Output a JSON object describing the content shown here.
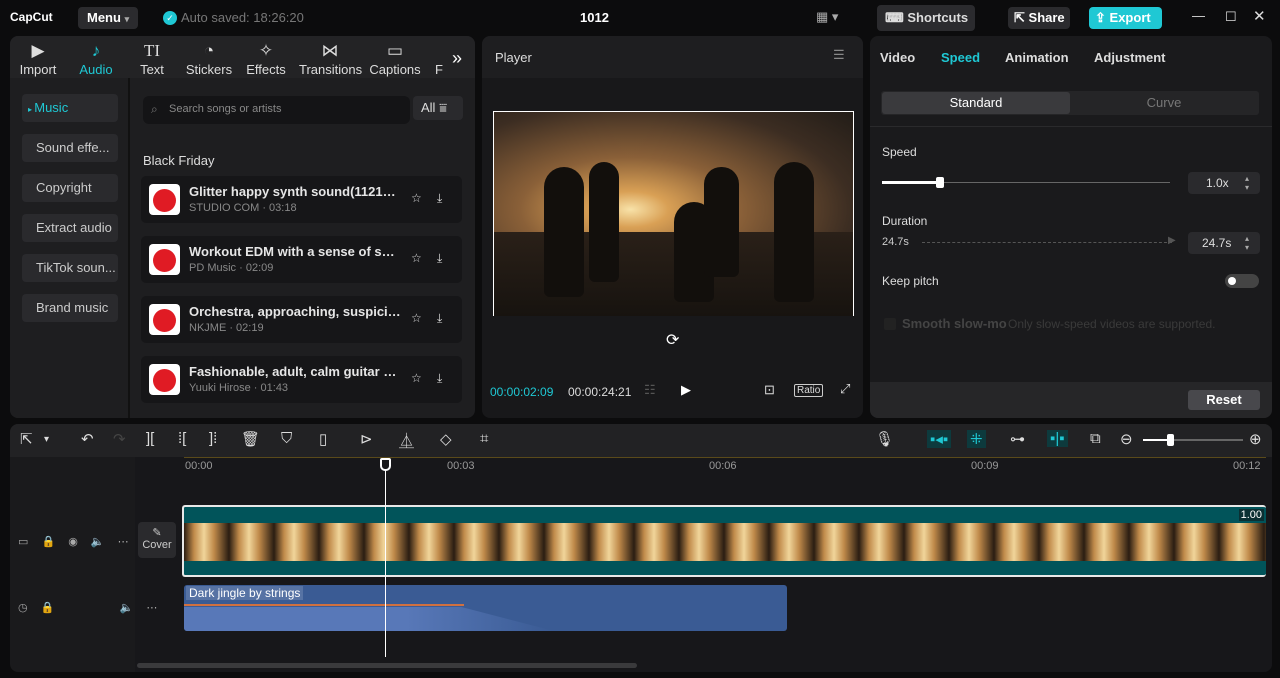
{
  "app": {
    "logo": "CapCut",
    "menu": "Menu",
    "autosave": "Auto saved: 18:26:20",
    "title": "1012",
    "shortcuts": "Shortcuts",
    "share": "Share",
    "export": "Export"
  },
  "media_tabs": [
    {
      "label": "Import",
      "icon": "▶"
    },
    {
      "label": "Audio",
      "icon": "♪"
    },
    {
      "label": "Text",
      "icon": "TI"
    },
    {
      "label": "Stickers",
      "icon": "◔"
    },
    {
      "label": "Effects",
      "icon": "✧"
    },
    {
      "label": "Transitions",
      "icon": "⋈"
    },
    {
      "label": "Captions",
      "icon": "▭"
    },
    {
      "label": "F",
      "icon": ""
    }
  ],
  "audio_sidebar": [
    "Music",
    "Sound effe...",
    "Copyright",
    "Extract audio",
    "TikTok soun...",
    "Brand music"
  ],
  "search": {
    "placeholder": "Search songs or artists",
    "filter": "All"
  },
  "section_title": "Black Friday",
  "tracks": [
    {
      "title": "Glitter happy synth sound(112170)",
      "meta": "STUDIO COM · 03:18"
    },
    {
      "title": "Workout EDM with a sense of speed",
      "meta": "PD Music · 02:09"
    },
    {
      "title": "Orchestra, approaching, suspicious",
      "meta": "NKJME · 02:19"
    },
    {
      "title": "Fashionable, adult, calm guitar BGM",
      "meta": "Yuuki Hirose · 01:43"
    }
  ],
  "player": {
    "title": "Player",
    "current": "00:00:02:09",
    "total": "00:00:24:21",
    "ratio": "Ratio"
  },
  "props": {
    "tabs": [
      "Video",
      "Speed",
      "Animation",
      "Adjustment"
    ],
    "modes": [
      "Standard",
      "Curve"
    ],
    "speed_label": "Speed",
    "speed_value": "1.0x",
    "speed_fraction": 0.1,
    "duration_label": "Duration",
    "duration_from": "24.7s",
    "duration_value": "24.7s",
    "keep_pitch": "Keep pitch",
    "smooth": "Smooth slow-mo",
    "smooth_note": "Only slow-speed videos are supported.",
    "reset": "Reset"
  },
  "timeline": {
    "ruler": [
      "00:00",
      "00:03",
      "00:06",
      "00:09",
      "00:12"
    ],
    "cover": "Cover",
    "clip_speed": "1.00",
    "audio_clip": "Dark jingle by strings"
  },
  "colors": {
    "accent": "#1fc8d4",
    "clip": "#01545a",
    "audio": "#3a5b94"
  }
}
